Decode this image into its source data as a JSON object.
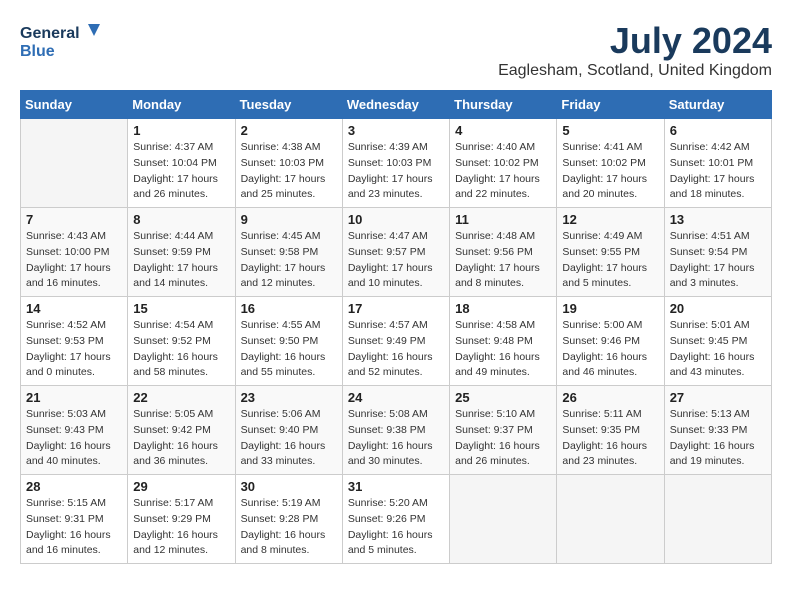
{
  "header": {
    "logo_line1": "General",
    "logo_line2": "Blue",
    "month_year": "July 2024",
    "location": "Eaglesham, Scotland, United Kingdom"
  },
  "days_of_week": [
    "Sunday",
    "Monday",
    "Tuesday",
    "Wednesday",
    "Thursday",
    "Friday",
    "Saturday"
  ],
  "weeks": [
    [
      {
        "day": "",
        "info": ""
      },
      {
        "day": "1",
        "info": "Sunrise: 4:37 AM\nSunset: 10:04 PM\nDaylight: 17 hours\nand 26 minutes."
      },
      {
        "day": "2",
        "info": "Sunrise: 4:38 AM\nSunset: 10:03 PM\nDaylight: 17 hours\nand 25 minutes."
      },
      {
        "day": "3",
        "info": "Sunrise: 4:39 AM\nSunset: 10:03 PM\nDaylight: 17 hours\nand 23 minutes."
      },
      {
        "day": "4",
        "info": "Sunrise: 4:40 AM\nSunset: 10:02 PM\nDaylight: 17 hours\nand 22 minutes."
      },
      {
        "day": "5",
        "info": "Sunrise: 4:41 AM\nSunset: 10:02 PM\nDaylight: 17 hours\nand 20 minutes."
      },
      {
        "day": "6",
        "info": "Sunrise: 4:42 AM\nSunset: 10:01 PM\nDaylight: 17 hours\nand 18 minutes."
      }
    ],
    [
      {
        "day": "7",
        "info": "Sunrise: 4:43 AM\nSunset: 10:00 PM\nDaylight: 17 hours\nand 16 minutes."
      },
      {
        "day": "8",
        "info": "Sunrise: 4:44 AM\nSunset: 9:59 PM\nDaylight: 17 hours\nand 14 minutes."
      },
      {
        "day": "9",
        "info": "Sunrise: 4:45 AM\nSunset: 9:58 PM\nDaylight: 17 hours\nand 12 minutes."
      },
      {
        "day": "10",
        "info": "Sunrise: 4:47 AM\nSunset: 9:57 PM\nDaylight: 17 hours\nand 10 minutes."
      },
      {
        "day": "11",
        "info": "Sunrise: 4:48 AM\nSunset: 9:56 PM\nDaylight: 17 hours\nand 8 minutes."
      },
      {
        "day": "12",
        "info": "Sunrise: 4:49 AM\nSunset: 9:55 PM\nDaylight: 17 hours\nand 5 minutes."
      },
      {
        "day": "13",
        "info": "Sunrise: 4:51 AM\nSunset: 9:54 PM\nDaylight: 17 hours\nand 3 minutes."
      }
    ],
    [
      {
        "day": "14",
        "info": "Sunrise: 4:52 AM\nSunset: 9:53 PM\nDaylight: 17 hours\nand 0 minutes."
      },
      {
        "day": "15",
        "info": "Sunrise: 4:54 AM\nSunset: 9:52 PM\nDaylight: 16 hours\nand 58 minutes."
      },
      {
        "day": "16",
        "info": "Sunrise: 4:55 AM\nSunset: 9:50 PM\nDaylight: 16 hours\nand 55 minutes."
      },
      {
        "day": "17",
        "info": "Sunrise: 4:57 AM\nSunset: 9:49 PM\nDaylight: 16 hours\nand 52 minutes."
      },
      {
        "day": "18",
        "info": "Sunrise: 4:58 AM\nSunset: 9:48 PM\nDaylight: 16 hours\nand 49 minutes."
      },
      {
        "day": "19",
        "info": "Sunrise: 5:00 AM\nSunset: 9:46 PM\nDaylight: 16 hours\nand 46 minutes."
      },
      {
        "day": "20",
        "info": "Sunrise: 5:01 AM\nSunset: 9:45 PM\nDaylight: 16 hours\nand 43 minutes."
      }
    ],
    [
      {
        "day": "21",
        "info": "Sunrise: 5:03 AM\nSunset: 9:43 PM\nDaylight: 16 hours\nand 40 minutes."
      },
      {
        "day": "22",
        "info": "Sunrise: 5:05 AM\nSunset: 9:42 PM\nDaylight: 16 hours\nand 36 minutes."
      },
      {
        "day": "23",
        "info": "Sunrise: 5:06 AM\nSunset: 9:40 PM\nDaylight: 16 hours\nand 33 minutes."
      },
      {
        "day": "24",
        "info": "Sunrise: 5:08 AM\nSunset: 9:38 PM\nDaylight: 16 hours\nand 30 minutes."
      },
      {
        "day": "25",
        "info": "Sunrise: 5:10 AM\nSunset: 9:37 PM\nDaylight: 16 hours\nand 26 minutes."
      },
      {
        "day": "26",
        "info": "Sunrise: 5:11 AM\nSunset: 9:35 PM\nDaylight: 16 hours\nand 23 minutes."
      },
      {
        "day": "27",
        "info": "Sunrise: 5:13 AM\nSunset: 9:33 PM\nDaylight: 16 hours\nand 19 minutes."
      }
    ],
    [
      {
        "day": "28",
        "info": "Sunrise: 5:15 AM\nSunset: 9:31 PM\nDaylight: 16 hours\nand 16 minutes."
      },
      {
        "day": "29",
        "info": "Sunrise: 5:17 AM\nSunset: 9:29 PM\nDaylight: 16 hours\nand 12 minutes."
      },
      {
        "day": "30",
        "info": "Sunrise: 5:19 AM\nSunset: 9:28 PM\nDaylight: 16 hours\nand 8 minutes."
      },
      {
        "day": "31",
        "info": "Sunrise: 5:20 AM\nSunset: 9:26 PM\nDaylight: 16 hours\nand 5 minutes."
      },
      {
        "day": "",
        "info": ""
      },
      {
        "day": "",
        "info": ""
      },
      {
        "day": "",
        "info": ""
      }
    ]
  ]
}
